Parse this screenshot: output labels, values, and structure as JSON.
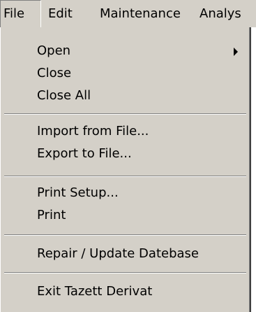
{
  "menubar": {
    "items": [
      {
        "label": "File"
      },
      {
        "label": "Edit"
      },
      {
        "label": "Maintenance"
      },
      {
        "label": "Analys"
      }
    ]
  },
  "file_menu": {
    "open": "Open",
    "close": "Close",
    "close_all": "Close All",
    "import": "Import from File...",
    "export": "Export to File...",
    "print_setup": "Print Setup...",
    "print": "Print",
    "repair": "Repair / Update Datebase",
    "exit": "Exit Tazett Derivat"
  },
  "icons": {
    "submenu": "chevron-right-icon"
  }
}
